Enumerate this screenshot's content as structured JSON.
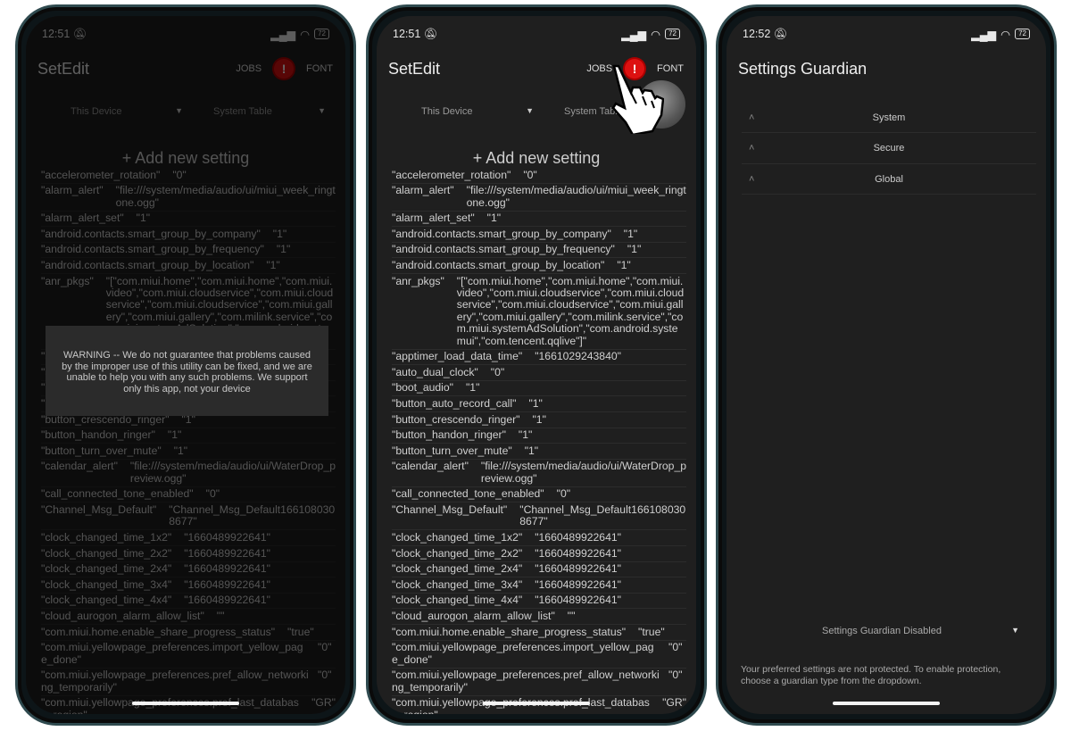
{
  "phones": [
    {
      "time": "12:51",
      "battery": "72"
    },
    {
      "time": "12:51",
      "battery": "72"
    },
    {
      "time": "12:52",
      "battery": "72"
    }
  ],
  "setedit": {
    "title": "SetEdit",
    "jobs_label": "JOBS",
    "alert_glyph": "!",
    "font_label": "FONT",
    "device_dropdown": "This Device",
    "table_dropdown": "System Table",
    "add_label": "+ Add new setting",
    "alert_color": "#dd1111",
    "settings": [
      [
        "\"accelerometer_rotation\"",
        "\"0\""
      ],
      [
        "\"alarm_alert\"",
        "\"file:///system/media/audio/ui/miui_week_ringtone.ogg\""
      ],
      [
        "\"alarm_alert_set\"",
        "\"1\""
      ],
      [
        "\"android.contacts.smart_group_by_company\"",
        "\"1\""
      ],
      [
        "\"android.contacts.smart_group_by_frequency\"",
        "\"1\""
      ],
      [
        "\"android.contacts.smart_group_by_location\"",
        "\"1\""
      ],
      [
        "\"anr_pkgs\"",
        "\"[\"com.miui.home\",\"com.miui.home\",\"com.miui.video\",\"com.miui.cloudservice\",\"com.miui.cloudservice\",\"com.miui.cloudservice\",\"com.miui.gallery\",\"com.miui.gallery\",\"com.milink.service\",\"com.miui.systemAdSolution\",\"com.android.systemui\",\"com.tencent.qqlive\"]\""
      ],
      [
        "\"apptimer_load_data_time\"",
        "\"1661029243840\""
      ],
      [
        "\"auto_dual_clock\"",
        "\"0\""
      ],
      [
        "\"boot_audio\"",
        "\"1\""
      ],
      [
        "\"button_auto_record_call\"",
        "\"1\""
      ],
      [
        "\"button_crescendo_ringer\"",
        "\"1\""
      ],
      [
        "\"button_handon_ringer\"",
        "\"1\""
      ],
      [
        "\"button_turn_over_mute\"",
        "\"1\""
      ],
      [
        "\"calendar_alert\"",
        "\"file:///system/media/audio/ui/WaterDrop_preview.ogg\""
      ],
      [
        "\"call_connected_tone_enabled\"",
        "\"0\""
      ],
      [
        "\"Channel_Msg_Default\"",
        "\"Channel_Msg_Default1661080308677\""
      ],
      [
        "\"clock_changed_time_1x2\"",
        "\"1660489922641\""
      ],
      [
        "\"clock_changed_time_2x2\"",
        "\"1660489922641\""
      ],
      [
        "\"clock_changed_time_2x4\"",
        "\"1660489922641\""
      ],
      [
        "\"clock_changed_time_3x4\"",
        "\"1660489922641\""
      ],
      [
        "\"clock_changed_time_4x4\"",
        "\"1660489922641\""
      ],
      [
        "\"cloud_aurogon_alarm_allow_list\"",
        "\"\""
      ],
      [
        "\"com.miui.home.enable_share_progress_status\"",
        "\"true\""
      ],
      [
        "\"com.miui.yellowpage_preferences.import_yellow_page_done\"",
        "\"0\""
      ],
      [
        "\"com.miui.yellowpage_preferences.pref_allow_networking_temporarily\"",
        "\"0\""
      ],
      [
        "\"com.miui.yellowpage_preferences.pref_last_database_region\"",
        "\"GR\""
      ]
    ],
    "warning": "WARNING -- We do not guarantee that problems caused by the improper use of this utility can be fixed, and we are unable to help you with any such problems. We support only this app, not your device"
  },
  "guardian": {
    "title": "Settings Guardian",
    "items": [
      "System",
      "Secure",
      "Global"
    ],
    "dropdown": "Settings Guardian Disabled",
    "note": "Your preferred settings are not protected. To enable protection, choose a guardian type from the dropdown."
  }
}
